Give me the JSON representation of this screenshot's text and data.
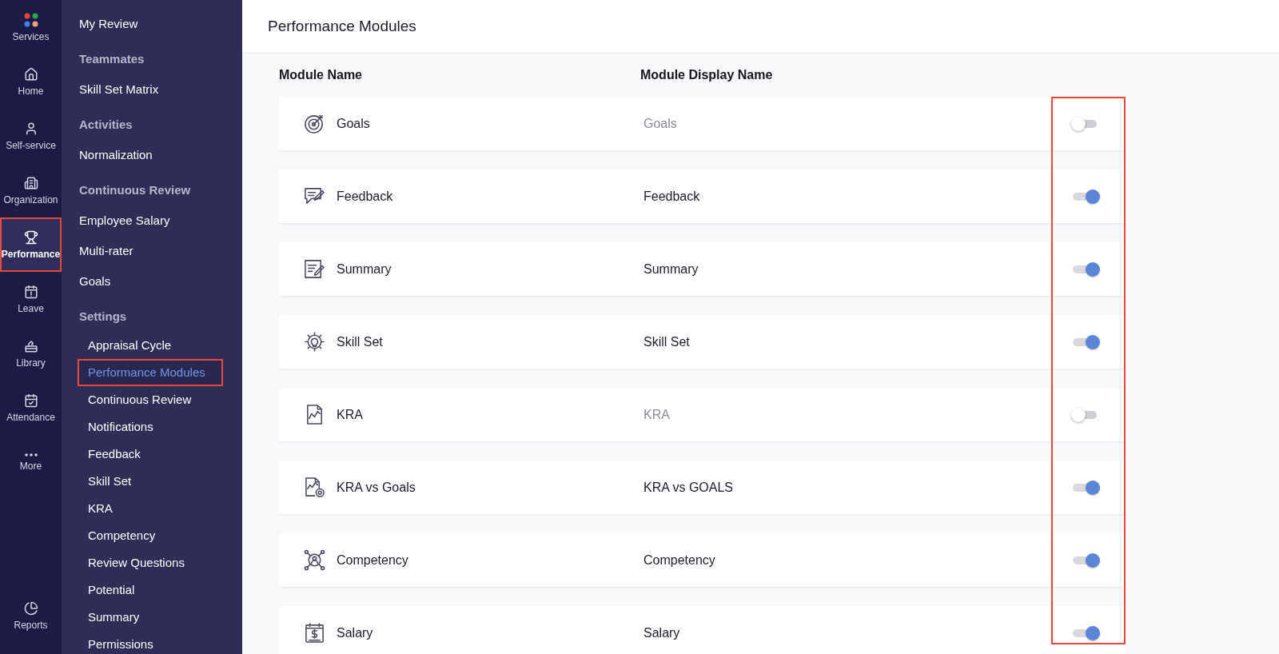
{
  "rail": {
    "items": [
      {
        "label": "Services",
        "selected": false,
        "highlighted": false
      },
      {
        "label": "Home",
        "selected": false,
        "highlighted": false
      },
      {
        "label": "Self-service",
        "selected": false,
        "highlighted": false
      },
      {
        "label": "Organization",
        "selected": false,
        "highlighted": false
      },
      {
        "label": "Performance",
        "selected": true,
        "highlighted": true
      },
      {
        "label": "Leave",
        "selected": false,
        "highlighted": false
      },
      {
        "label": "Library",
        "selected": false,
        "highlighted": false
      },
      {
        "label": "Attendance",
        "selected": false,
        "highlighted": false
      },
      {
        "label": "More",
        "selected": false,
        "highlighted": false
      }
    ],
    "bottom_items": [
      {
        "label": "Reports",
        "selected": false,
        "highlighted": false
      }
    ]
  },
  "sidebar": {
    "items": [
      {
        "kind": "link",
        "label": "My Review",
        "selected": false,
        "highlighted": false
      },
      {
        "kind": "heading",
        "label": "Teammates"
      },
      {
        "kind": "link",
        "label": "Skill Set Matrix",
        "selected": false,
        "highlighted": false
      },
      {
        "kind": "heading",
        "label": "Activities"
      },
      {
        "kind": "link",
        "label": "Normalization",
        "selected": false,
        "highlighted": false
      },
      {
        "kind": "heading",
        "label": "Continuous Review"
      },
      {
        "kind": "link",
        "label": "Employee Salary",
        "selected": false,
        "highlighted": false
      },
      {
        "kind": "link",
        "label": "Multi-rater",
        "selected": false,
        "highlighted": false
      },
      {
        "kind": "link",
        "label": "Goals",
        "selected": false,
        "highlighted": false
      },
      {
        "kind": "heading",
        "label": "Settings",
        "children": [
          {
            "kind": "link",
            "label": "Appraisal Cycle",
            "selected": false,
            "highlighted": false
          },
          {
            "kind": "link",
            "label": "Performance Modules",
            "selected": true,
            "highlighted": true
          },
          {
            "kind": "link",
            "label": "Continuous Review",
            "selected": false,
            "highlighted": false
          },
          {
            "kind": "link",
            "label": "Notifications",
            "selected": false,
            "highlighted": false
          },
          {
            "kind": "link",
            "label": "Feedback",
            "selected": false,
            "highlighted": false
          },
          {
            "kind": "link",
            "label": "Skill Set",
            "selected": false,
            "highlighted": false
          },
          {
            "kind": "link",
            "label": "KRA",
            "selected": false,
            "highlighted": false
          },
          {
            "kind": "link",
            "label": "Competency",
            "selected": false,
            "highlighted": false
          },
          {
            "kind": "link",
            "label": "Review Questions",
            "selected": false,
            "highlighted": false
          },
          {
            "kind": "link",
            "label": "Potential",
            "selected": false,
            "highlighted": false
          },
          {
            "kind": "link",
            "label": "Summary",
            "selected": false,
            "highlighted": false
          },
          {
            "kind": "link",
            "label": "Permissions",
            "selected": false,
            "highlighted": false
          }
        ]
      }
    ]
  },
  "page": {
    "title": "Performance Modules"
  },
  "table": {
    "columns": [
      "Module Name",
      "Module Display Name"
    ],
    "toggle_column_highlighted": true,
    "rows": [
      {
        "name": "Goals",
        "display_name": "Goals",
        "enabled": false
      },
      {
        "name": "Feedback",
        "display_name": "Feedback",
        "enabled": true
      },
      {
        "name": "Summary",
        "display_name": "Summary",
        "enabled": true
      },
      {
        "name": "Skill Set",
        "display_name": "Skill Set",
        "enabled": true
      },
      {
        "name": "KRA",
        "display_name": "KRA",
        "enabled": false
      },
      {
        "name": "KRA vs Goals",
        "display_name": "KRA vs GOALS",
        "enabled": true
      },
      {
        "name": "Competency",
        "display_name": "Competency",
        "enabled": true
      },
      {
        "name": "Salary",
        "display_name": "Salary",
        "enabled": true
      }
    ]
  }
}
